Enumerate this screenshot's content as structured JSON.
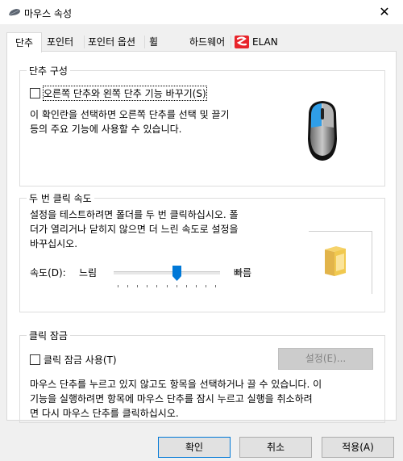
{
  "window": {
    "title": "마우스 속성",
    "close_label": "✕"
  },
  "tabs": [
    {
      "label": "단추",
      "selected": true
    },
    {
      "label": "포인터"
    },
    {
      "label": "포인터 옵션"
    },
    {
      "label": "휠"
    },
    {
      "label": "하드웨어"
    },
    {
      "label": "ELAN"
    }
  ],
  "button_config": {
    "title": "단추 구성",
    "swap_checkbox_label": "오른쪽 단추와 왼쪽 단추 기능 바꾸기(S)",
    "swap_checked": false,
    "description_line1": "이 확인란을 선택하면 오른쪽 단추를 선택 및 끌기",
    "description_line2": "등의 주요 기능에 사용할 수 있습니다."
  },
  "double_click": {
    "title": "두 번 클릭 속도",
    "description_line1": "설정을 테스트하려면 폴더를 두 번 클릭하십시오. 폴",
    "description_line2": "더가 열리거나 닫히지 않으면 더 느린 속도로 설정을",
    "description_line3": "바꾸십시오.",
    "speed_label": "속도(D):",
    "slow_label": "느림",
    "fast_label": "빠름",
    "speed_level": 0.6
  },
  "click_lock": {
    "title": "클릭 잠금",
    "checkbox_label": "클릭 잠금 사용(T)",
    "checked": false,
    "settings_button": "설정(E)...",
    "description_line1": "마우스 단추를 누르고 있지 않고도 항목을 선택하거나 끌 수 있습니다. 이",
    "description_line2": "기능을 실행하려면 항목에 마우스 단추를 잠시 누르고 실행을 취소하려",
    "description_line3": "면 다시 마우스 단추를 클릭하십시오."
  },
  "footer": {
    "ok": "확인",
    "cancel": "취소",
    "apply": "적용(A)"
  },
  "colors": {
    "accent_blue": "#0078d7",
    "mouse_blue": "#2f9ee8",
    "folder_yellow": "#f6d36b",
    "elan_red": "#e8242b"
  },
  "icons": [
    "mouse-title-icon",
    "close-icon",
    "elan-logo-icon",
    "mouse-illustration-icon",
    "folder-icon"
  ]
}
